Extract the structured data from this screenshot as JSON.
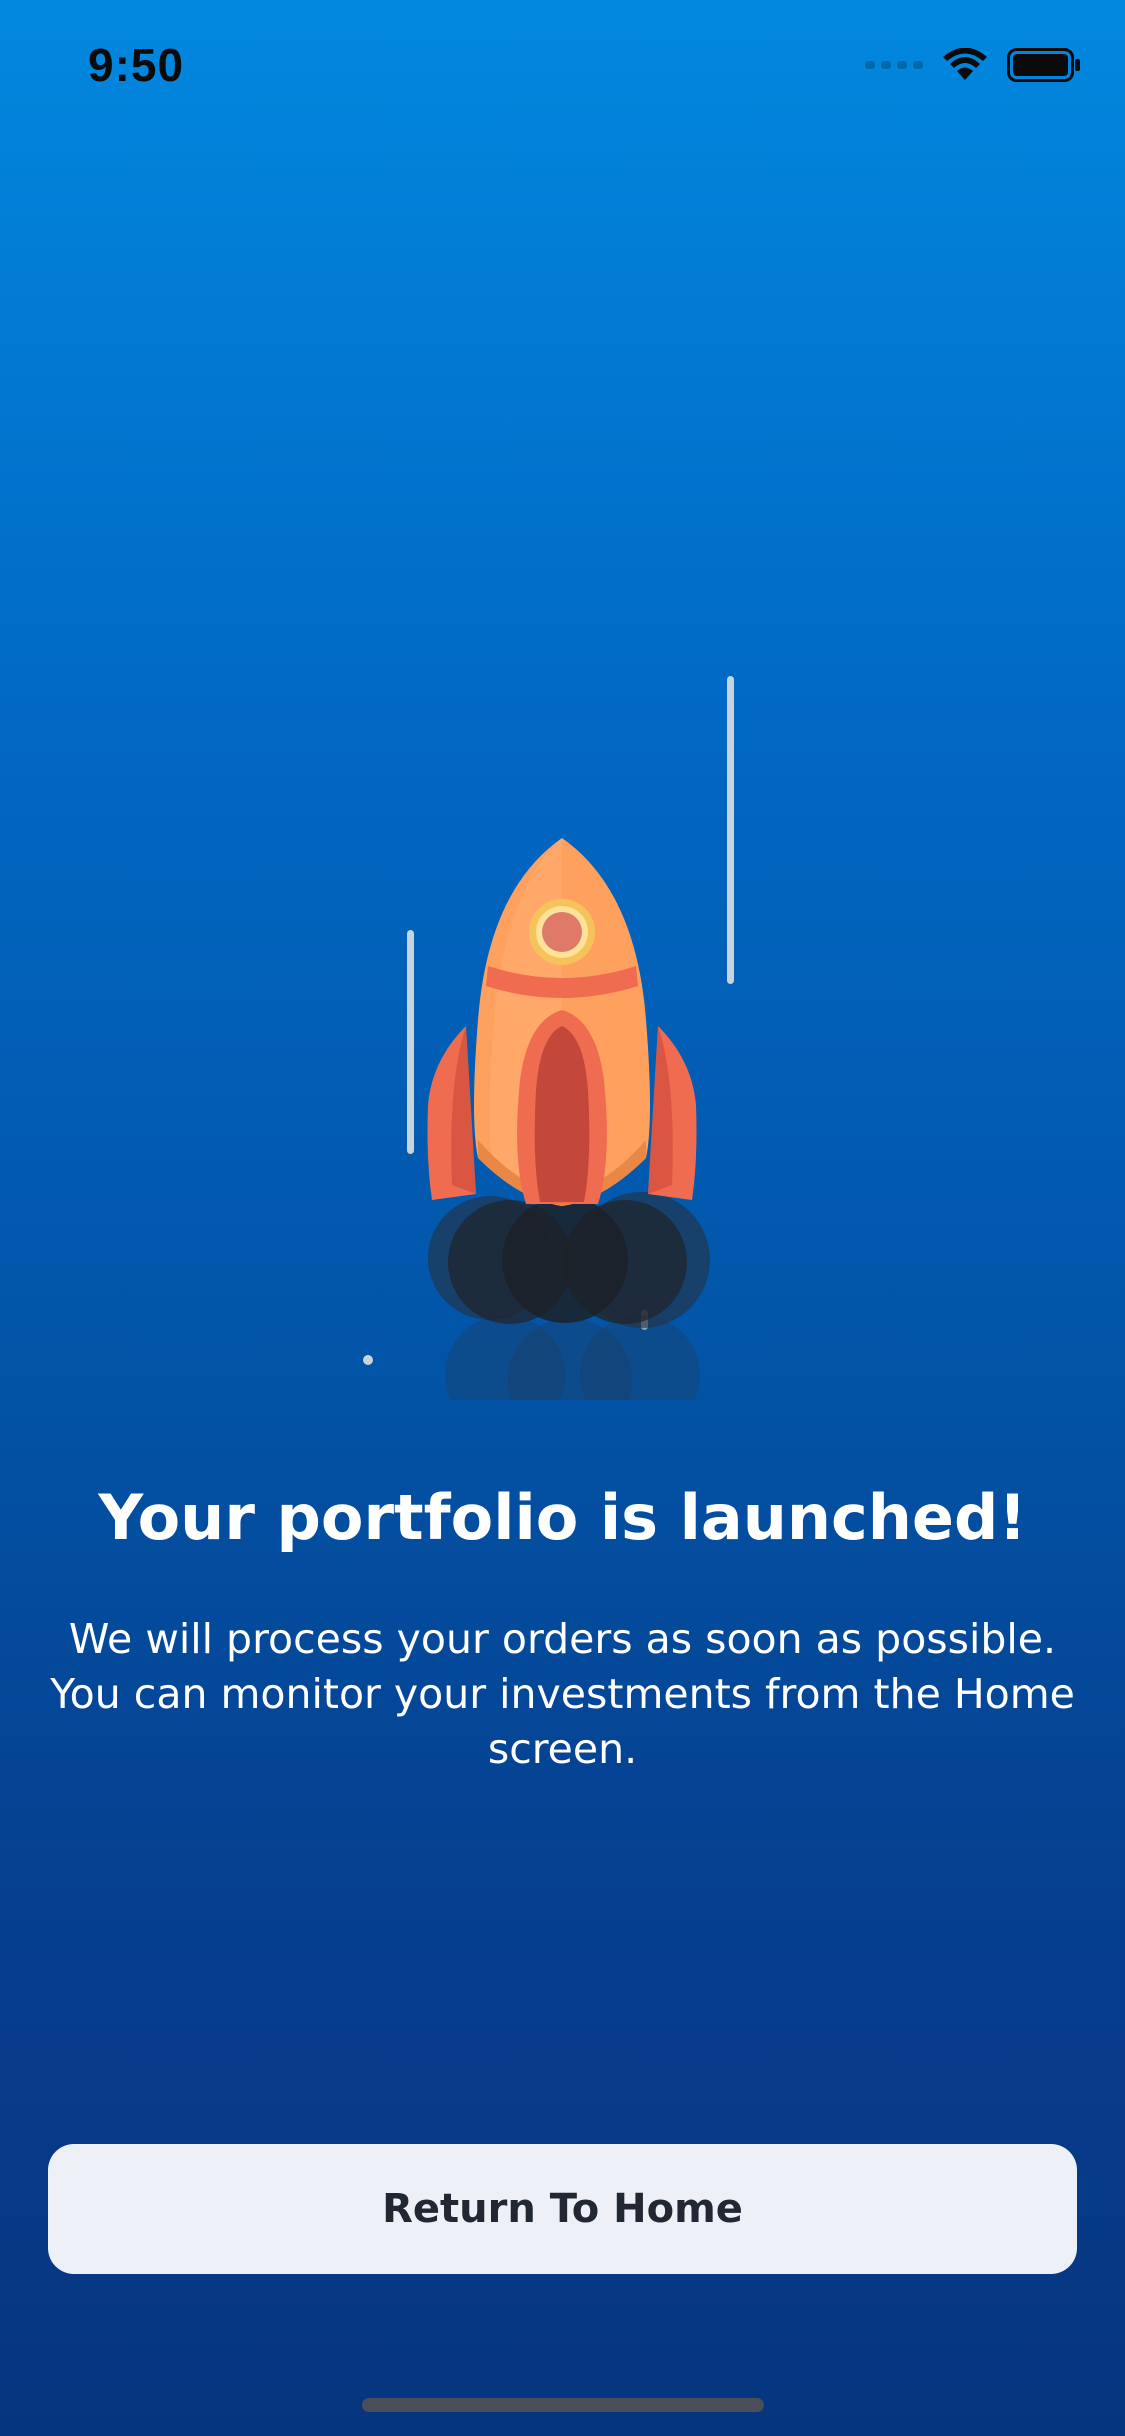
{
  "status_bar": {
    "time": "9:50",
    "icons": [
      "cellular-signal-icon",
      "wifi-icon",
      "battery-icon"
    ]
  },
  "illustration": {
    "icon": "rocket-icon"
  },
  "content": {
    "headline": "Your portfolio is launched!",
    "message": "We will process your orders as soon as possible. You can monitor your investments from the Home screen."
  },
  "actions": {
    "return_home_label": "Return To Home"
  },
  "colors": {
    "background_top": "#0288df",
    "background_bottom": "#06357f",
    "button_background": "#eef0f7",
    "button_text": "#222833",
    "rocket_body": "#ffa15e",
    "rocket_fins": "#ef6c50",
    "rocket_window": "#e07a68"
  }
}
